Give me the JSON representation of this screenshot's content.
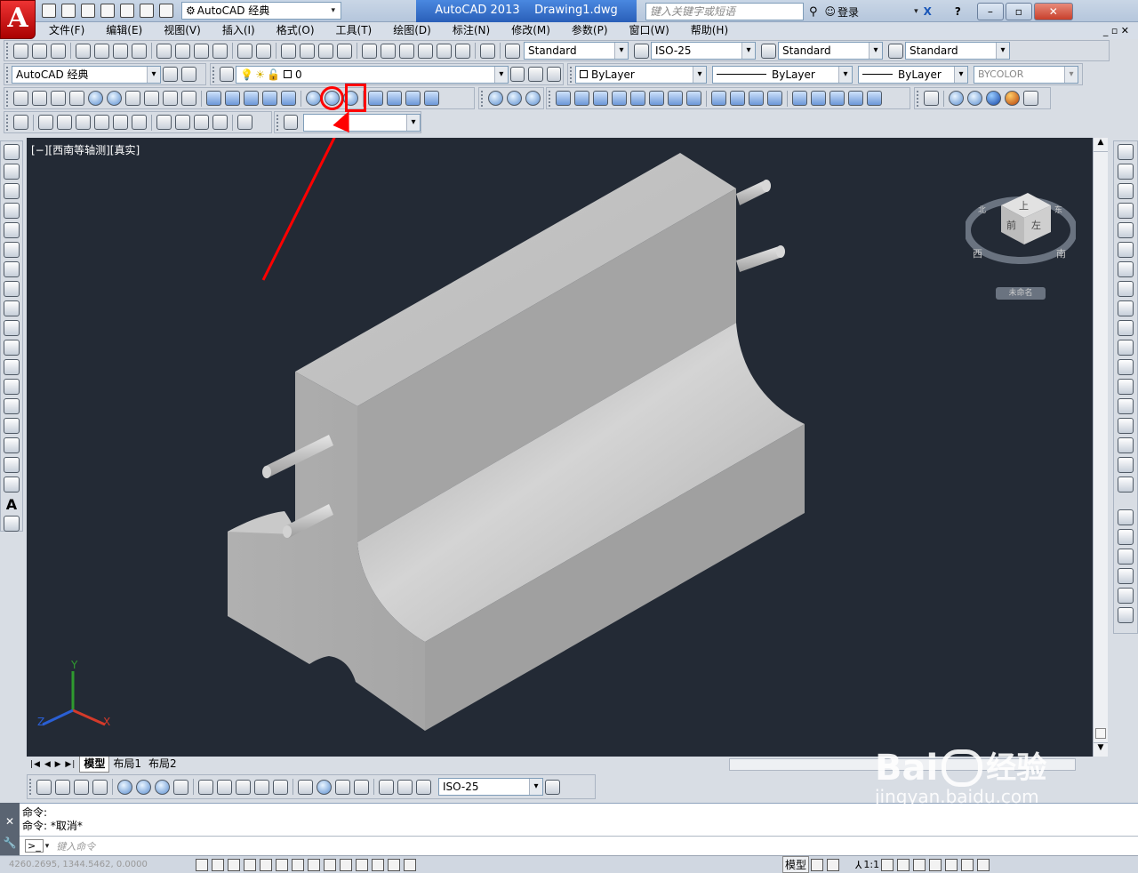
{
  "title": {
    "app_name": "AutoCAD 2013",
    "file_name": "Drawing1.dwg",
    "workspace": "AutoCAD 经典",
    "search_placeholder": "键入关键字或短语",
    "login_label": "登录"
  },
  "menubar": [
    "文件(F)",
    "编辑(E)",
    "视图(V)",
    "插入(I)",
    "格式(O)",
    "工具(T)",
    "绘图(D)",
    "标注(N)",
    "修改(M)",
    "参数(P)",
    "窗口(W)",
    "帮助(H)"
  ],
  "styles": {
    "text_style": "Standard",
    "dim_style": "ISO-25",
    "table_style": "Standard",
    "mleader_style": "Standard"
  },
  "workspace_combo": "AutoCAD 经典",
  "layer": {
    "current": "0"
  },
  "properties": {
    "color": "ByLayer",
    "linetype": "ByLayer",
    "lineweight": "ByLayer",
    "plotstyle": "BYCOLOR"
  },
  "viewport": {
    "label": "[−][西南等轴测][真实]",
    "background": "#232a35",
    "viewcube": {
      "top": "上",
      "front": "前",
      "left": "左",
      "west": "西",
      "south": "南",
      "north": "北",
      "east": "东",
      "wcs_label": "未命名"
    },
    "ucs": {
      "x": "X",
      "y": "Y",
      "z": "Z"
    }
  },
  "annotation": {
    "color": "#ff0000",
    "note": "highlighted toolbar icon"
  },
  "tabs": [
    "模型",
    "布局1",
    "布局2"
  ],
  "dim_toolbar": {
    "dim_style": "ISO-25"
  },
  "command": {
    "line1": "命令:",
    "line2": "命令: *取消*",
    "input_placeholder": "键入命令"
  },
  "status": {
    "coords": "4260.2695, 1344.5462, 0.0000",
    "model_label": "模型",
    "scale": "1:1"
  },
  "watermark": {
    "brand": "Bai",
    "brand_tail": "经验",
    "url": "jingyan.baidu.com"
  }
}
